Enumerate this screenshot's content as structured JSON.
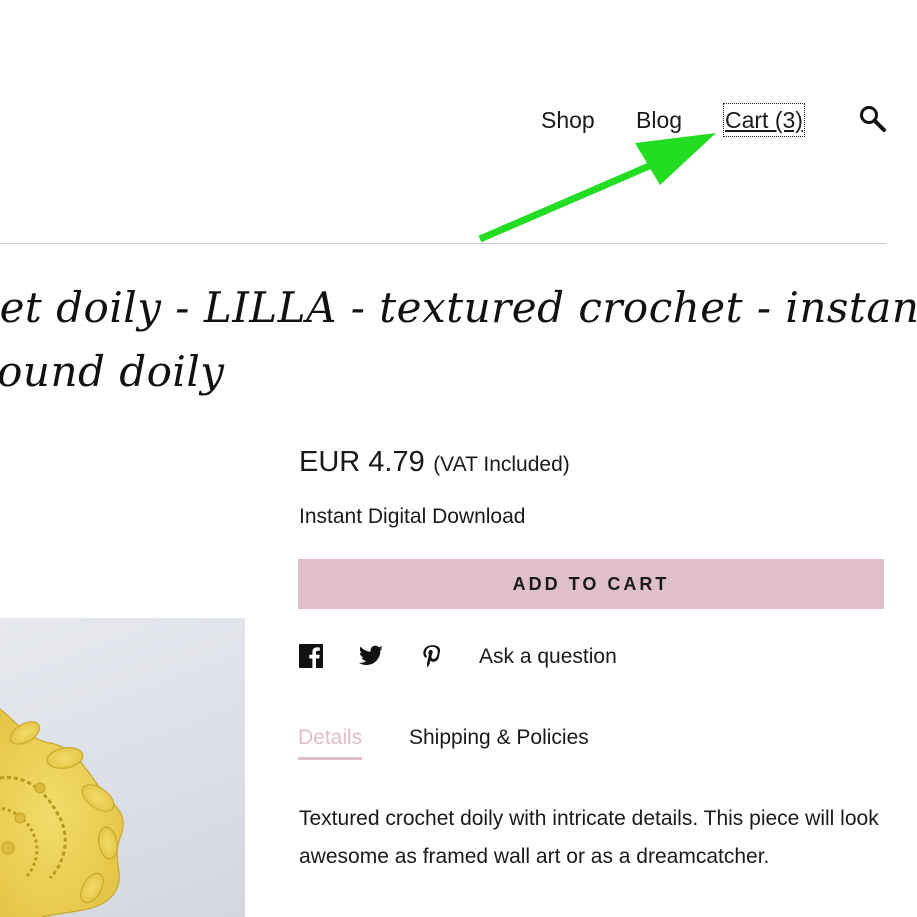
{
  "nav": {
    "shop_label": "Shop",
    "blog_label": "Blog",
    "cart_label": "Cart (3)",
    "search_icon": "search-icon"
  },
  "listing": {
    "title_line1": "chet doily - LILLA - textured crochet - instant",
    "title_line2": "- round doily"
  },
  "buy_box": {
    "price": "EUR 4.79",
    "vat_note": "(VAT Included)",
    "delivery_note": "Instant Digital Download",
    "add_to_cart_label": "ADD TO CART",
    "button_color": "#dfbfca"
  },
  "share": {
    "icons": [
      "facebook-icon",
      "twitter-icon",
      "pinterest-icon"
    ],
    "ask_label": "Ask a question"
  },
  "tabs": {
    "details_label": "Details",
    "shipping_label": "Shipping & Policies",
    "active_color": "#dfbfca"
  },
  "description": {
    "text": "Textured crochet doily with intricate details. This piece will look awesome as framed wall art or as a dreamcatcher."
  },
  "annotation": {
    "arrow_color": "#22dd22"
  }
}
